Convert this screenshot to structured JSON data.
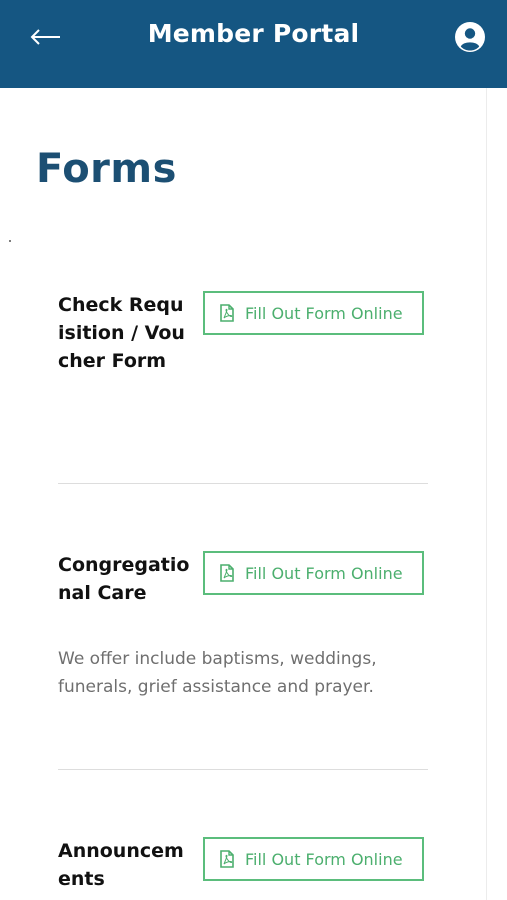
{
  "header": {
    "title": "Member Portal",
    "back_icon": "arrow-left-icon",
    "profile_icon": "user-circle-icon",
    "background_color": "#155682"
  },
  "page": {
    "title": "Forms",
    "title_color": "#1c4f73"
  },
  "forms": [
    {
      "name": "Check Requisition / Voucher Form",
      "button_label": "Fill Out Form Online",
      "button_icon": "pdf-file-icon"
    },
    {
      "name": "Congregational Care",
      "description": "We offer include baptisms, weddings, funerals, grief assistance and prayer.",
      "button_label": "Fill Out Form Online",
      "button_icon": "pdf-file-icon"
    },
    {
      "name": "Announcements",
      "button_label": "Fill Out Form Online",
      "button_icon": "pdf-file-icon"
    }
  ],
  "colors": {
    "accent_green": "#5bbd7c"
  }
}
